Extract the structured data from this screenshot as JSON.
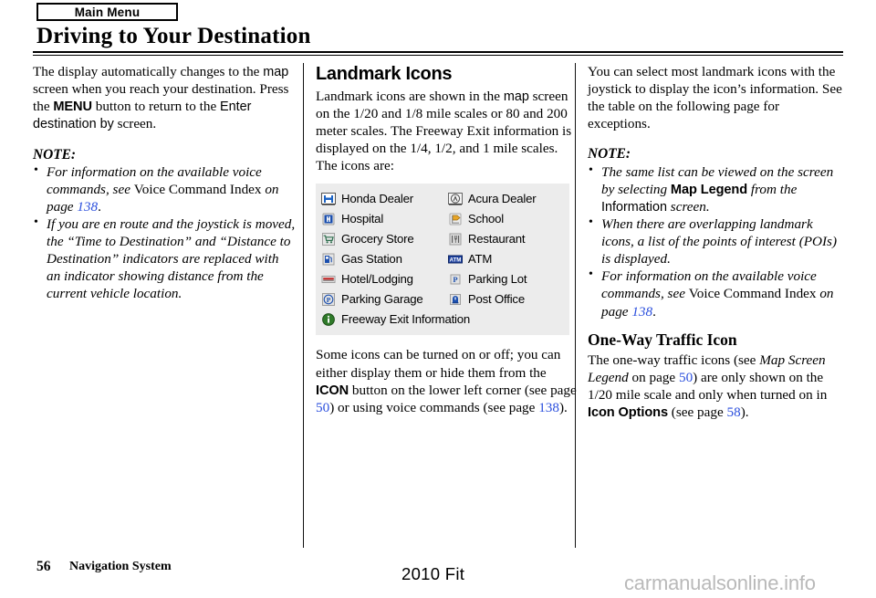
{
  "header": {
    "tab_label": "Main Menu",
    "title": "Driving to Your Destination"
  },
  "left_column": {
    "paragraph_1": {
      "t1": "The display automatically changes to the ",
      "map": "map",
      "t2": " screen when you reach your destination. Press the ",
      "menu": "MENU",
      "t3": " button to return to the ",
      "enter_destination_by": "Enter destination by",
      "t4": " screen."
    },
    "note_heading": "NOTE:",
    "notes": [
      {
        "t1": "For information on the available voice commands, see ",
        "t2": "Voice Command Index",
        "t3": " on page ",
        "page": "138",
        "t4": "."
      },
      {
        "t1": "If you are en route and the joystick is moved, the “Time to Destination” and “Distance to Destination” indicators are replaced with an indicator showing distance from the current vehicle location.",
        "t2": "",
        "t3": "",
        "page": "",
        "t4": ""
      }
    ]
  },
  "middle_column": {
    "heading": "Landmark Icons",
    "paragraph_1": {
      "t1": "Landmark icons are shown in the ",
      "map": "map",
      "t2": " screen on the 1/20 and 1/8 mile scales or 80 and 200 meter scales. The Freeway Exit information is displayed on the 1/4, 1/2, and 1 mile scales. The icons are:"
    },
    "icon_table": {
      "background_color": "#ececec",
      "rows": [
        {
          "left": {
            "icon": "honda-dealer-icon",
            "label": "Honda Dealer"
          },
          "right": {
            "icon": "acura-dealer-icon",
            "label": "Acura Dealer"
          }
        },
        {
          "left": {
            "icon": "hospital-icon",
            "label": "Hospital"
          },
          "right": {
            "icon": "school-icon",
            "label": "School"
          }
        },
        {
          "left": {
            "icon": "grocery-store-icon",
            "label": "Grocery Store"
          },
          "right": {
            "icon": "restaurant-icon",
            "label": "Restaurant"
          }
        },
        {
          "left": {
            "icon": "gas-station-icon",
            "label": "Gas Station"
          },
          "right": {
            "icon": "atm-icon",
            "label": "ATM"
          }
        },
        {
          "left": {
            "icon": "hotel-lodging-icon",
            "label": "Hotel/Lodging"
          },
          "right": {
            "icon": "parking-lot-icon",
            "label": "Parking Lot"
          }
        },
        {
          "left": {
            "icon": "parking-garage-icon",
            "label": "Parking Garage"
          },
          "right": {
            "icon": "post-office-icon",
            "label": "Post Office"
          }
        },
        {
          "left": {
            "icon": "freeway-exit-info-icon",
            "label": "Freeway Exit Information"
          },
          "right": {
            "icon": "",
            "label": ""
          }
        }
      ]
    },
    "paragraph_2": {
      "t1": "Some icons can be turned on or off; you can either display them or hide them from the ",
      "icon_btn": "ICON",
      "t2": " button on the lower left corner (see page ",
      "page_50": "50",
      "t3": ") or using voice commands (see page ",
      "page_138": "138",
      "t4": ")."
    }
  },
  "right_column": {
    "paragraph_1": "You can select most landmark icons with the joystick to display the icon’s information. See the table on the following page for exceptions.",
    "note_heading": "NOTE:",
    "notes": [
      {
        "t1": "The same list can be viewed on the screen by selecting ",
        "b1": "Map Legend",
        "t2": " from the ",
        "b2": "Information",
        "t3": " screen."
      },
      {
        "t1": "When there are overlapping landmark icons, a list of the points of interest (POIs) is displayed.",
        "b1": "",
        "t2": "",
        "b2": "",
        "t3": ""
      },
      {
        "t1": "For information on the available voice commands, see ",
        "b1": "Voice Command Index",
        "t2": " on page ",
        "b2": "138",
        "t3": "."
      }
    ],
    "section_heading": "One-Way Traffic Icon",
    "paragraph_2": {
      "t1": "The one-way traffic icons (see ",
      "italic1": "Map Screen Legend",
      "t2": " on page ",
      "page_50": "50",
      "t3": ") are only shown on the 1/20 mile scale and only when turned on in ",
      "icon_options": "Icon Options",
      "t4": " (see page ",
      "page_58": "58",
      "t5": ")."
    }
  },
  "footer": {
    "page_number": "56",
    "section": "Navigation System",
    "model": "2010 Fit",
    "watermark": "carmanualsonline.info"
  },
  "colors": {
    "page_link": "#2b4fdd",
    "table_bg": "#ececec",
    "watermark": "#b9b9b9"
  }
}
